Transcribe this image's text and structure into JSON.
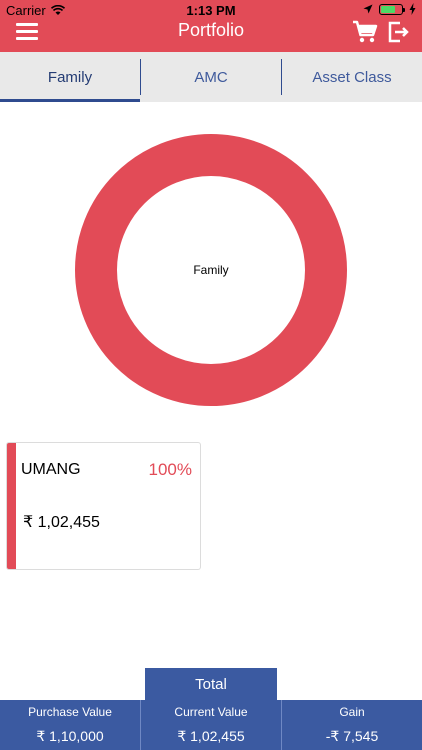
{
  "status_bar": {
    "carrier": "Carrier",
    "time": "1:13 PM"
  },
  "header": {
    "title": "Portfolio"
  },
  "tabs": [
    {
      "label": "Family",
      "active": true
    },
    {
      "label": "AMC",
      "active": false
    },
    {
      "label": "Asset Class",
      "active": false
    }
  ],
  "chart_data": {
    "type": "pie",
    "center_label": "Family",
    "categories": [
      "UMANG"
    ],
    "values": [
      100
    ],
    "colors": [
      "#e24b57"
    ]
  },
  "card": {
    "name": "UMANG",
    "percent": "100%",
    "amount": "₹ 1,02,455"
  },
  "total": {
    "label": "Total",
    "purchase_label": "Purchase Value",
    "purchase_value": "₹ 1,10,000",
    "current_label": "Current Value",
    "current_value": "₹ 1,02,455",
    "gain_label": "Gain",
    "gain_value": "-₹ 7,545"
  },
  "colors": {
    "brand": "#e24b57",
    "footer": "#3b5aa1"
  }
}
